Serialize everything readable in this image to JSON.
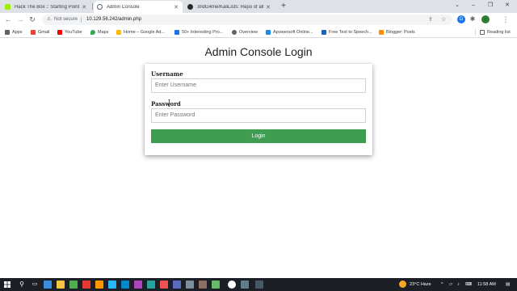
{
  "browser": {
    "tabs": [
      {
        "title": "Hack The Box :: Starting Point",
        "active": false,
        "favicon_color": "#9fef00"
      },
      {
        "title": "Admin Console",
        "active": true,
        "favicon_color": "#5f6368"
      },
      {
        "title": "3ndG4me/KaliLists: Repo of all the",
        "active": false,
        "favicon_color": "#24292e"
      }
    ],
    "new_tab_label": "+",
    "window_controls": {
      "dropdown": "⌄",
      "minimize": "–",
      "restore": "❐",
      "close": "✕"
    },
    "address": {
      "security_label": "Not secure",
      "url": "10.129.56.242/admin.php"
    },
    "extensions": [
      {
        "name": "extension-g",
        "letter": "G",
        "color": "#1a73e8"
      },
      {
        "name": "extension-puzzle",
        "letter": "✱",
        "color": "#5f6368"
      },
      {
        "name": "profile",
        "letter": "●",
        "color": "#2e7d32"
      }
    ],
    "bookmarks": [
      {
        "label": "Apps",
        "icon_color": "#5f6368"
      },
      {
        "label": "Gmail",
        "icon_color": "#ea4335"
      },
      {
        "label": "YouTube",
        "icon_color": "#ff0000"
      },
      {
        "label": "Maps",
        "icon_color": "#34a853"
      },
      {
        "label": "Home – Google Ad...",
        "icon_color": "#fbbc04"
      },
      {
        "label": "50+ Interesting Pro...",
        "icon_color": "#1a73e8"
      },
      {
        "label": "Overview",
        "icon_color": "#5f6368"
      },
      {
        "label": "Apowersoft Online...",
        "icon_color": "#1e88e5"
      },
      {
        "label": "Free Text to Speech...",
        "icon_color": "#1565c0"
      },
      {
        "label": "Blogger: Posts",
        "icon_color": "#ff8f00"
      }
    ],
    "reading_list_label": "Reading list"
  },
  "page": {
    "title": "Admin Console Login",
    "username_label": "Username",
    "username_placeholder": "Enter Username",
    "username_value": "",
    "password_label": "Password",
    "password_placeholder": "Enter Password",
    "password_value": "",
    "login_button": "Login",
    "login_button_color": "#3e9d50"
  },
  "taskbar": {
    "weather": "23°C  Haze",
    "time": "11:58 AM"
  }
}
